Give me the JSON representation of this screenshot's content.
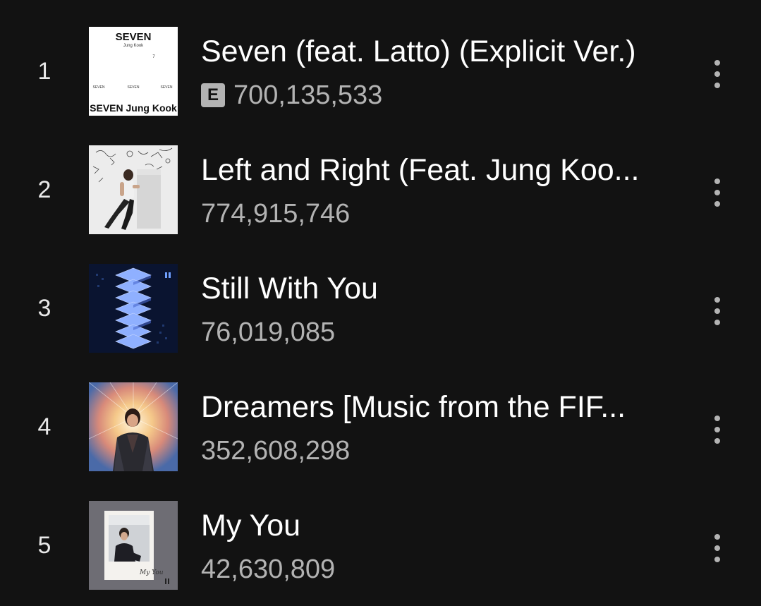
{
  "tracks": [
    {
      "rank": "1",
      "title": "Seven (feat. Latto) (Explicit Ver.)",
      "explicit": true,
      "explicit_label": "E",
      "plays": "700,135,533",
      "cover": {
        "title_text": "SEVEN",
        "artist_text": "Jung Kook",
        "number_text": "7",
        "small_labels": [
          "SEVEN",
          "SEVEN",
          "SEVEN"
        ],
        "bottom_text": "SEVEN Jung Kook"
      }
    },
    {
      "rank": "2",
      "title": "Left and Right (Feat. Jung Koo...",
      "explicit": false,
      "plays": "774,915,746"
    },
    {
      "rank": "3",
      "title": "Still With You",
      "explicit": false,
      "plays": "76,019,085"
    },
    {
      "rank": "4",
      "title": "Dreamers [Music from the FIF...",
      "explicit": false,
      "plays": "352,608,298"
    },
    {
      "rank": "5",
      "title": "My You",
      "explicit": false,
      "plays": "42,630,809",
      "cover": {
        "script_text": "My You"
      }
    }
  ],
  "icons": {
    "more": "more-vertical-icon",
    "explicit": "explicit-icon"
  },
  "colors": {
    "background": "#121212",
    "title": "#ffffff",
    "secondary": "#b3b3b3"
  }
}
